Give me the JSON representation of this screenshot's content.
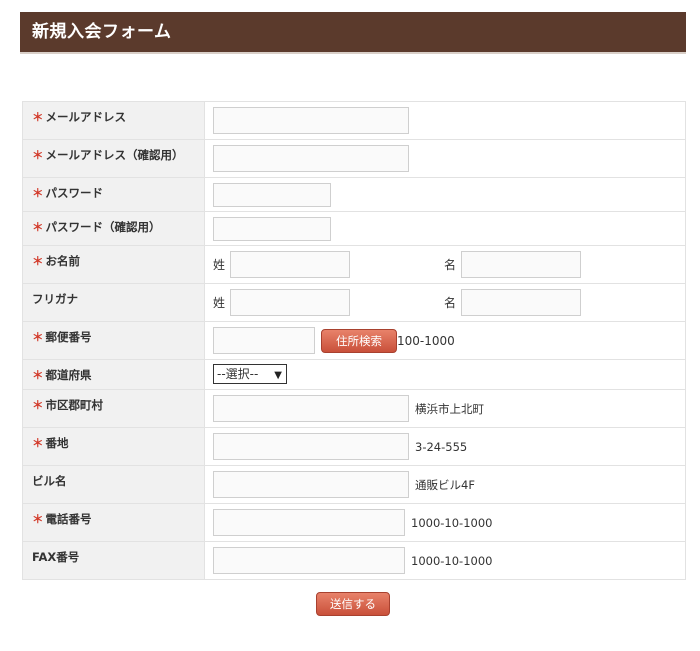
{
  "header": {
    "title": "新規入会フォーム"
  },
  "required_mark": "＊",
  "rows": {
    "email": {
      "label": "メールアドレス"
    },
    "email_confirm": {
      "label": "メールアドレス（確認用）"
    },
    "password": {
      "label": "パスワード"
    },
    "password_confirm": {
      "label": "パスワード（確認用）"
    },
    "name": {
      "label": "お名前",
      "last_prefix": "姓",
      "first_prefix": "名"
    },
    "furigana": {
      "label": "フリガナ",
      "last_prefix": "姓",
      "first_prefix": "名"
    },
    "zip": {
      "label": "郵便番号",
      "button": "住所検索",
      "example": "100-1000"
    },
    "prefecture": {
      "label": "都道府県",
      "selected": "--選択--"
    },
    "city": {
      "label": "市区郡町村",
      "example": "横浜市上北町"
    },
    "address": {
      "label": "番地",
      "example": "3-24-555"
    },
    "building": {
      "label": "ビル名",
      "example": "通販ビル4F"
    },
    "phone": {
      "label": "電話番号",
      "example": "1000-10-1000"
    },
    "fax": {
      "label": "FAX番号",
      "example": "1000-10-1000"
    }
  },
  "submit": {
    "label": "送信する"
  },
  "colors": {
    "header_bg": "#5b3a2c",
    "required": "#d23a2a",
    "button": "#d5614a"
  }
}
